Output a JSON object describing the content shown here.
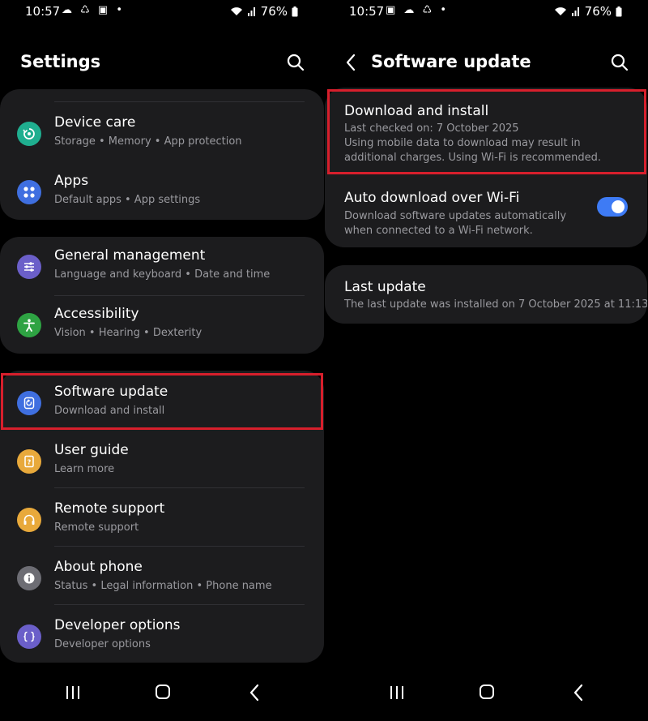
{
  "left": {
    "status": {
      "time": "10:57",
      "battery": "76%"
    },
    "title": "Settings",
    "card1": [
      {
        "title": "Device care",
        "subtitle": "Storage  •  Memory  •  App protection",
        "icon": "device-care-icon",
        "color": "#1fae8f"
      },
      {
        "title": "Apps",
        "subtitle": "Default apps  •  App settings",
        "icon": "apps-icon",
        "color": "#3f6fe0"
      }
    ],
    "card2": [
      {
        "title": "General management",
        "subtitle": "Language and keyboard  •  Date and time",
        "icon": "sliders-icon",
        "color": "#6b5fc9"
      },
      {
        "title": "Accessibility",
        "subtitle": "Vision  •  Hearing  •  Dexterity",
        "icon": "accessibility-icon",
        "color": "#2ea343"
      }
    ],
    "card3": [
      {
        "title": "Software update",
        "subtitle": "Download and install",
        "icon": "software-update-icon",
        "color": "#3f6fe0"
      },
      {
        "title": "User guide",
        "subtitle": "Learn more",
        "icon": "user-guide-icon",
        "color": "#e8a93b"
      },
      {
        "title": "Remote support",
        "subtitle": "Remote support",
        "icon": "headset-icon",
        "color": "#e8a93b"
      },
      {
        "title": "About phone",
        "subtitle": "Status  •  Legal information  •  Phone name",
        "icon": "info-icon",
        "color": "#6d6d74"
      },
      {
        "title": "Developer options",
        "subtitle": "Developer options",
        "icon": "developer-icon",
        "color": "#6b5fc9"
      }
    ]
  },
  "right": {
    "status": {
      "time": "10:57",
      "battery": "76%"
    },
    "title": "Software update",
    "download": {
      "title": "Download and install",
      "checked": "Last checked on: 7 October 2025",
      "note": "Using mobile data to download may result in additional charges. Using Wi-Fi is recommended."
    },
    "auto": {
      "title": "Auto download over Wi-Fi",
      "subtitle": "Download software updates automatically when connected to a Wi-Fi network.",
      "enabled": true
    },
    "last": {
      "title": "Last update",
      "subtitle": "The last update was installed on 7 October 2025 at 11:13."
    }
  },
  "colors": {
    "highlight": "#d71f2c",
    "toggle_on": "#3e7bf5",
    "card": "#1c1c1e"
  }
}
